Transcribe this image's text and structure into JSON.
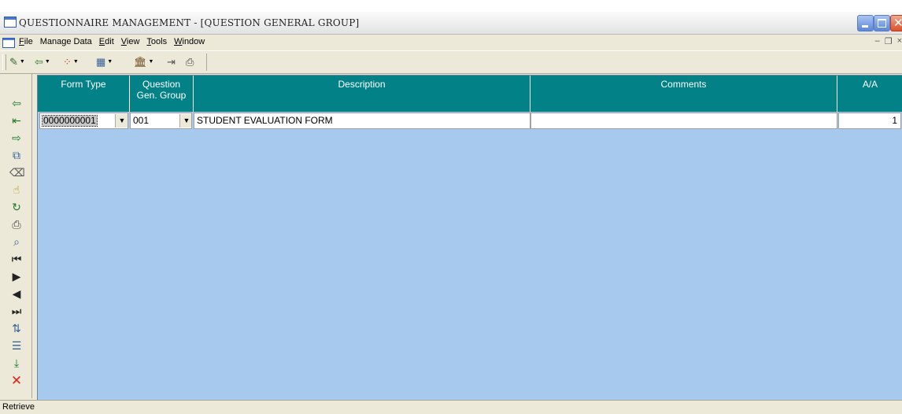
{
  "window": {
    "title": "QUESTIONNAIRE MANAGEMENT - [QUESTION GENERAL GROUP]"
  },
  "menu": {
    "items": [
      {
        "label_u": "F",
        "label_rest": "ile"
      },
      {
        "label_u": "",
        "label_rest": "Manage Data"
      },
      {
        "label_u": "E",
        "label_rest": "dit"
      },
      {
        "label_u": "V",
        "label_rest": "iew"
      },
      {
        "label_u": "T",
        "label_rest": "ools"
      },
      {
        "label_u": "W",
        "label_rest": "indow"
      }
    ]
  },
  "toolbar": {
    "icons": [
      "edit-menu-icon",
      "insert-row-icon",
      "filter-icon",
      "grid-view-icon",
      "reports-icon",
      "exit-door-icon",
      "print-icon"
    ]
  },
  "left_toolbar": {
    "icons": [
      "insert-icon",
      "append-icon",
      "delete-icon",
      "copy-icon",
      "erase-icon",
      "query-icon",
      "refresh-icon",
      "print-icon",
      "preview-icon",
      "first-record-icon",
      "next-record-icon",
      "previous-record-icon",
      "last-record-icon",
      "sort-icon",
      "filter-list-icon",
      "save-icon",
      "cancel-icon"
    ]
  },
  "grid": {
    "columns": [
      "Form Type",
      "Question\nGen. Group",
      "Description",
      "Comments",
      "A/A"
    ],
    "rows": [
      {
        "form_type": "0000000001",
        "question_gen_group": "001",
        "description": "STUDENT EVALUATION FORM",
        "comments": "",
        "aa": "1"
      }
    ]
  },
  "status": {
    "text": "Retrieve"
  },
  "colors": {
    "header_bg": "#028186",
    "grid_bg": "#a7c9ee",
    "close_button": "#d9512b"
  }
}
